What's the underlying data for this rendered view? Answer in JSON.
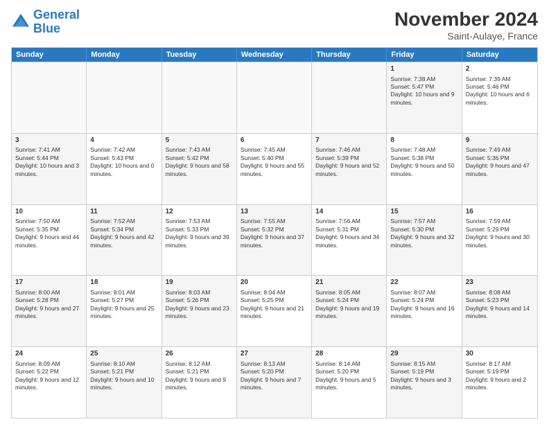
{
  "logo": {
    "line1": "General",
    "line2": "Blue"
  },
  "title": "November 2024",
  "subtitle": "Saint-Aulaye, France",
  "header_days": [
    "Sunday",
    "Monday",
    "Tuesday",
    "Wednesday",
    "Thursday",
    "Friday",
    "Saturday"
  ],
  "weeks": [
    [
      {
        "day": "",
        "content": "",
        "empty": true
      },
      {
        "day": "",
        "content": "",
        "empty": true
      },
      {
        "day": "",
        "content": "",
        "empty": true
      },
      {
        "day": "",
        "content": "",
        "empty": true
      },
      {
        "day": "",
        "content": "",
        "empty": true
      },
      {
        "day": "1",
        "content": "Sunrise: 7:38 AM\nSunset: 5:47 PM\nDaylight: 10 hours and 9 minutes.",
        "empty": false,
        "shaded": true
      },
      {
        "day": "2",
        "content": "Sunrise: 7:39 AM\nSunset: 5:46 PM\nDaylight: 10 hours and 6 minutes.",
        "empty": false,
        "shaded": false
      }
    ],
    [
      {
        "day": "3",
        "content": "Sunrise: 7:41 AM\nSunset: 5:44 PM\nDaylight: 10 hours and 3 minutes.",
        "empty": false,
        "shaded": true
      },
      {
        "day": "4",
        "content": "Sunrise: 7:42 AM\nSunset: 5:43 PM\nDaylight: 10 hours and 0 minutes.",
        "empty": false,
        "shaded": false
      },
      {
        "day": "5",
        "content": "Sunrise: 7:43 AM\nSunset: 5:42 PM\nDaylight: 9 hours and 58 minutes.",
        "empty": false,
        "shaded": true
      },
      {
        "day": "6",
        "content": "Sunrise: 7:45 AM\nSunset: 5:40 PM\nDaylight: 9 hours and 55 minutes.",
        "empty": false,
        "shaded": false
      },
      {
        "day": "7",
        "content": "Sunrise: 7:46 AM\nSunset: 5:39 PM\nDaylight: 9 hours and 52 minutes.",
        "empty": false,
        "shaded": true
      },
      {
        "day": "8",
        "content": "Sunrise: 7:48 AM\nSunset: 5:38 PM\nDaylight: 9 hours and 50 minutes.",
        "empty": false,
        "shaded": false
      },
      {
        "day": "9",
        "content": "Sunrise: 7:49 AM\nSunset: 5:36 PM\nDaylight: 9 hours and 47 minutes.",
        "empty": false,
        "shaded": true
      }
    ],
    [
      {
        "day": "10",
        "content": "Sunrise: 7:50 AM\nSunset: 5:35 PM\nDaylight: 9 hours and 44 minutes.",
        "empty": false,
        "shaded": false
      },
      {
        "day": "11",
        "content": "Sunrise: 7:52 AM\nSunset: 5:34 PM\nDaylight: 9 hours and 42 minutes.",
        "empty": false,
        "shaded": true
      },
      {
        "day": "12",
        "content": "Sunrise: 7:53 AM\nSunset: 5:33 PM\nDaylight: 9 hours and 39 minutes.",
        "empty": false,
        "shaded": false
      },
      {
        "day": "13",
        "content": "Sunrise: 7:55 AM\nSunset: 5:32 PM\nDaylight: 9 hours and 37 minutes.",
        "empty": false,
        "shaded": true
      },
      {
        "day": "14",
        "content": "Sunrise: 7:56 AM\nSunset: 5:31 PM\nDaylight: 9 hours and 34 minutes.",
        "empty": false,
        "shaded": false
      },
      {
        "day": "15",
        "content": "Sunrise: 7:57 AM\nSunset: 5:30 PM\nDaylight: 9 hours and 32 minutes.",
        "empty": false,
        "shaded": true
      },
      {
        "day": "16",
        "content": "Sunrise: 7:59 AM\nSunset: 5:29 PM\nDaylight: 9 hours and 30 minutes.",
        "empty": false,
        "shaded": false
      }
    ],
    [
      {
        "day": "17",
        "content": "Sunrise: 8:00 AM\nSunset: 5:28 PM\nDaylight: 9 hours and 27 minutes.",
        "empty": false,
        "shaded": true
      },
      {
        "day": "18",
        "content": "Sunrise: 8:01 AM\nSunset: 5:27 PM\nDaylight: 9 hours and 25 minutes.",
        "empty": false,
        "shaded": false
      },
      {
        "day": "19",
        "content": "Sunrise: 8:03 AM\nSunset: 5:26 PM\nDaylight: 9 hours and 23 minutes.",
        "empty": false,
        "shaded": true
      },
      {
        "day": "20",
        "content": "Sunrise: 8:04 AM\nSunset: 5:25 PM\nDaylight: 9 hours and 21 minutes.",
        "empty": false,
        "shaded": false
      },
      {
        "day": "21",
        "content": "Sunrise: 8:05 AM\nSunset: 5:24 PM\nDaylight: 9 hours and 19 minutes.",
        "empty": false,
        "shaded": true
      },
      {
        "day": "22",
        "content": "Sunrise: 8:07 AM\nSunset: 5:24 PM\nDaylight: 9 hours and 16 minutes.",
        "empty": false,
        "shaded": false
      },
      {
        "day": "23",
        "content": "Sunrise: 8:08 AM\nSunset: 5:23 PM\nDaylight: 9 hours and 14 minutes.",
        "empty": false,
        "shaded": true
      }
    ],
    [
      {
        "day": "24",
        "content": "Sunrise: 8:09 AM\nSunset: 5:22 PM\nDaylight: 9 hours and 12 minutes.",
        "empty": false,
        "shaded": false
      },
      {
        "day": "25",
        "content": "Sunrise: 8:10 AM\nSunset: 5:21 PM\nDaylight: 9 hours and 10 minutes.",
        "empty": false,
        "shaded": true
      },
      {
        "day": "26",
        "content": "Sunrise: 8:12 AM\nSunset: 5:21 PM\nDaylight: 9 hours and 9 minutes.",
        "empty": false,
        "shaded": false
      },
      {
        "day": "27",
        "content": "Sunrise: 8:13 AM\nSunset: 5:20 PM\nDaylight: 9 hours and 7 minutes.",
        "empty": false,
        "shaded": true
      },
      {
        "day": "28",
        "content": "Sunrise: 8:14 AM\nSunset: 5:20 PM\nDaylight: 9 hours and 5 minutes.",
        "empty": false,
        "shaded": false
      },
      {
        "day": "29",
        "content": "Sunrise: 8:15 AM\nSunset: 5:19 PM\nDaylight: 9 hours and 3 minutes.",
        "empty": false,
        "shaded": true
      },
      {
        "day": "30",
        "content": "Sunrise: 8:17 AM\nSunset: 5:19 PM\nDaylight: 9 hours and 2 minutes.",
        "empty": false,
        "shaded": false
      }
    ]
  ]
}
